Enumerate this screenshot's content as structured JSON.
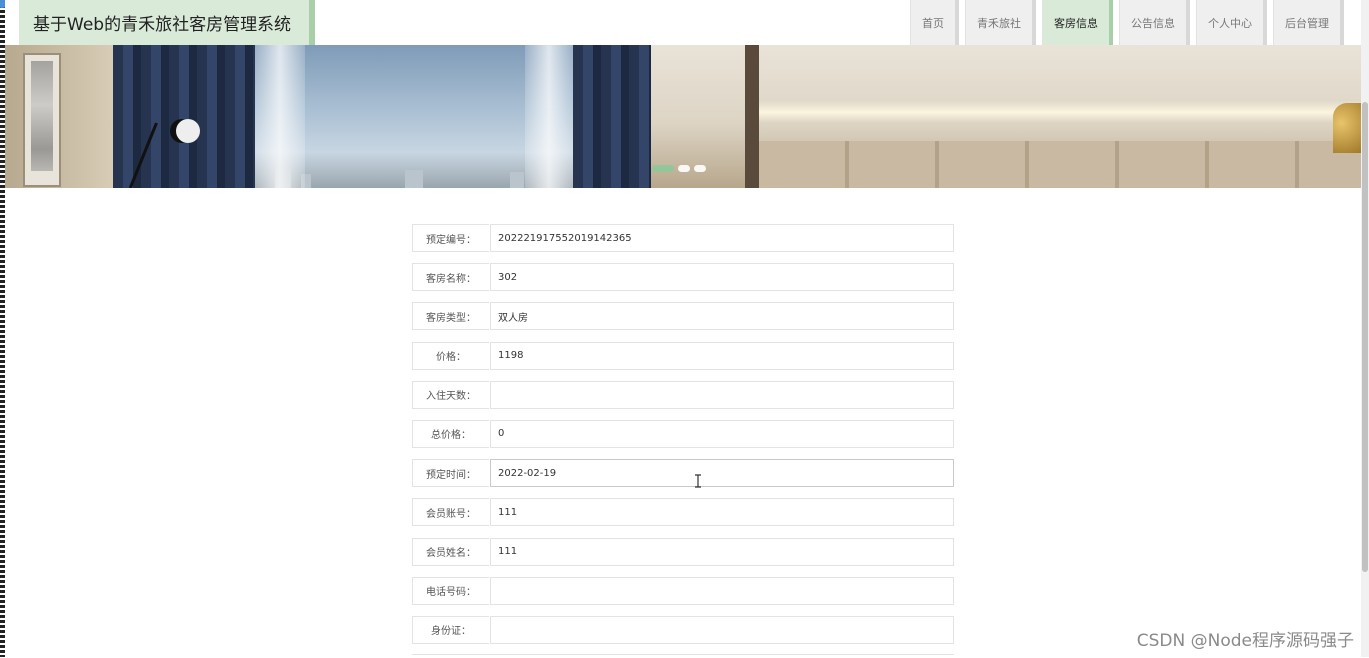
{
  "header": {
    "title": "基于Web的青禾旅社客房管理系统",
    "nav": [
      {
        "label": "首页",
        "active": false
      },
      {
        "label": "青禾旅社",
        "active": false
      },
      {
        "label": "客房信息",
        "active": true
      },
      {
        "label": "公告信息",
        "active": false
      },
      {
        "label": "个人中心",
        "active": false
      },
      {
        "label": "后台管理",
        "active": false
      }
    ]
  },
  "banner": {
    "carousel_dots": 3,
    "active_dot": 1,
    "accent_color": "#8fc79a"
  },
  "form": {
    "fields": [
      {
        "label": "预定编号：",
        "value": "20222191755201914236​5"
      },
      {
        "label": "客房名称：",
        "value": "302"
      },
      {
        "label": "客房类型：",
        "value": "双人房"
      },
      {
        "label": "价格：",
        "value": "1198"
      },
      {
        "label": "入住天数：",
        "value": ""
      },
      {
        "label": "总价格：",
        "value": "0"
      },
      {
        "label": "预定时间：",
        "value": "2022-02-19"
      },
      {
        "label": "会员账号：",
        "value": "111"
      },
      {
        "label": "会员姓名：",
        "value": "111"
      },
      {
        "label": "电话号码：",
        "value": ""
      },
      {
        "label": "身份证：",
        "value": ""
      }
    ]
  },
  "watermark": "CSDN @Node程序源码强子",
  "colors": {
    "nav_active": "#d9ead9",
    "nav_active_border": "#a8cfa8",
    "nav_default": "#efefef"
  }
}
